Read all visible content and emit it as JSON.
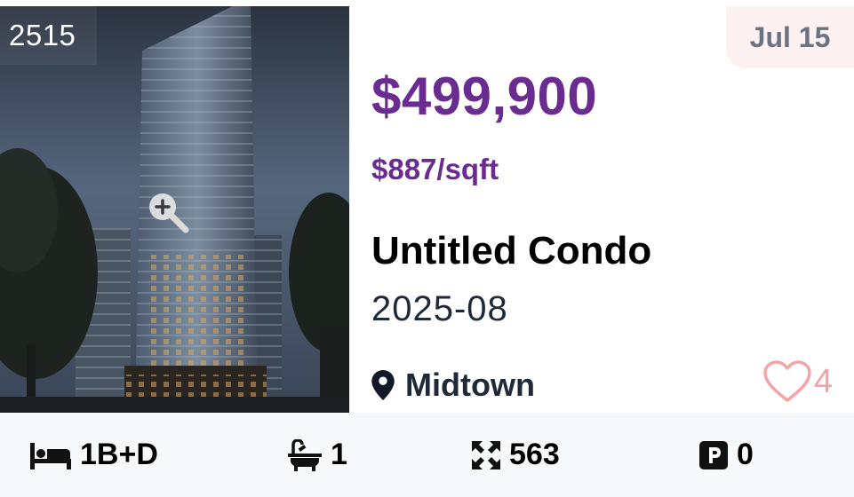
{
  "listing": {
    "id_badge": "2515",
    "date": "Jul 15",
    "price": "$499,900",
    "price_per_sqft": "$887/sqft",
    "title": "Untitled Condo",
    "occupancy": "2025-08",
    "location": "Midtown",
    "favorites_count": "4"
  },
  "stats": {
    "beds": "1B+D",
    "baths": "1",
    "size": "563",
    "parking": "0"
  },
  "icons": {
    "zoom": "zoom-in-icon",
    "location": "map-pin-icon",
    "favorite": "heart-outline-icon",
    "beds": "bed-icon",
    "baths": "bathtub-icon",
    "size": "expand-arrows-icon",
    "parking": "parking-icon"
  },
  "colors": {
    "price": "#6a2c91",
    "date_badge_bg": "#fdf1f1",
    "heart": "#f4a4a8",
    "footer_bg": "#f7f8fa"
  }
}
